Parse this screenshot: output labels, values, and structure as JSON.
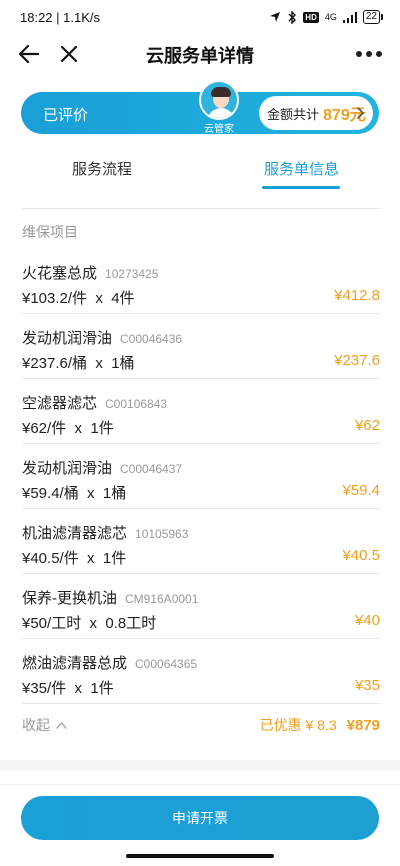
{
  "status": {
    "time": "18:22 | 1.1K/s",
    "signal": "4G",
    "hd": "HD",
    "battery": "22"
  },
  "nav": {
    "title": "云服务单详情"
  },
  "banner": {
    "status": "已评价",
    "agent_label": "云管家",
    "amount_label": "金额共计",
    "amount_value": "879元"
  },
  "tabs": [
    {
      "label": "服务流程"
    },
    {
      "label": "服务单信息"
    }
  ],
  "section_title": "维保项目",
  "items": [
    {
      "name": "火花塞总成",
      "code": "10273425",
      "qty": "¥103.2/件  x  4件",
      "total": "¥412.8"
    },
    {
      "name": "发动机润滑油",
      "code": "C00046436",
      "qty": "¥237.6/桶  x  1桶",
      "total": "¥237.6"
    },
    {
      "name": "空滤器滤芯",
      "code": "C00106843",
      "qty": "¥62/件  x  1件",
      "total": "¥62"
    },
    {
      "name": "发动机润滑油",
      "code": "C00046437",
      "qty": "¥59.4/桶  x  1桶",
      "total": "¥59.4"
    },
    {
      "name": "机油滤清器滤芯",
      "code": "10105963",
      "qty": "¥40.5/件  x  1件",
      "total": "¥40.5"
    },
    {
      "name": "保养-更换机油",
      "code": "CM916A0001",
      "qty": "¥50/工时  x  0.8工时",
      "total": "¥40"
    },
    {
      "name": "燃油滤清器总成",
      "code": "C00064365",
      "qty": "¥35/件  x  1件",
      "total": "¥35"
    }
  ],
  "footer": {
    "collapse_label": "收起",
    "discount": "已优惠 ¥ 8.3",
    "final": "¥879"
  },
  "apply_button": "申请开票",
  "colors": {
    "accent": "#1a9fd6",
    "price": "#f0a020"
  }
}
